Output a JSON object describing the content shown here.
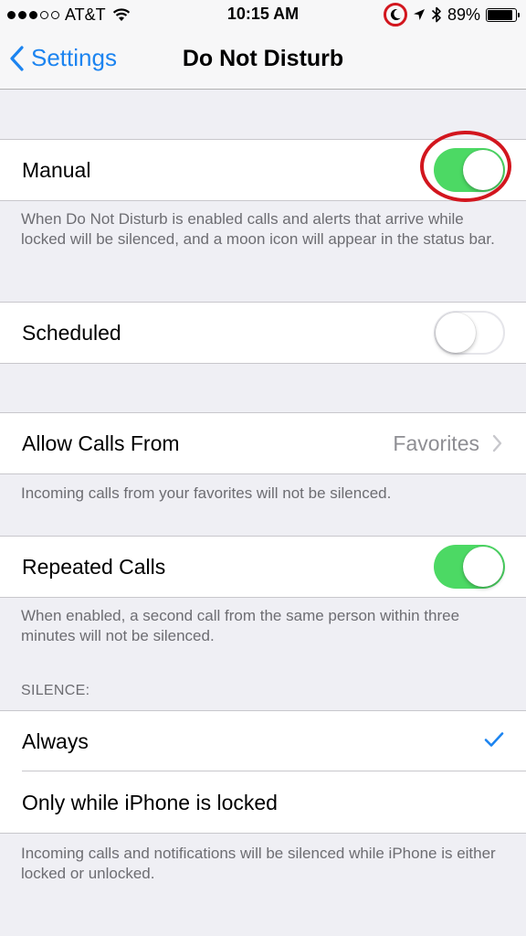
{
  "status_bar": {
    "carrier": "AT&T",
    "time": "10:15 AM",
    "battery_percent": "89%",
    "battery_level": 0.89,
    "icons": [
      "signal-dots-icon",
      "wifi-icon",
      "moon-icon",
      "location-arrow-icon",
      "bluetooth-icon",
      "battery-icon"
    ]
  },
  "nav": {
    "back_label": "Settings",
    "title": "Do Not Disturb"
  },
  "manual": {
    "label": "Manual",
    "toggle_on": true,
    "footer": "When Do Not Disturb is enabled calls and alerts that arrive while locked will be silenced, and a moon icon will appear in the status bar."
  },
  "scheduled": {
    "label": "Scheduled",
    "toggle_on": false
  },
  "allow_calls": {
    "label": "Allow Calls From",
    "value": "Favorites",
    "footer": "Incoming calls from your favorites will not be silenced."
  },
  "repeated_calls": {
    "label": "Repeated Calls",
    "toggle_on": true,
    "footer": "When enabled, a second call from the same person within three minutes will not be silenced."
  },
  "silence": {
    "header": "SILENCE:",
    "options": [
      {
        "label": "Always",
        "selected": true
      },
      {
        "label": "Only while iPhone is locked",
        "selected": false
      }
    ],
    "footer": "Incoming calls and notifications will be silenced while iPhone is either locked or unlocked."
  },
  "colors": {
    "accent_blue": "#1c84f0",
    "toggle_green": "#4cd964",
    "annotation_red": "#d2161e",
    "background": "#efeff4"
  }
}
